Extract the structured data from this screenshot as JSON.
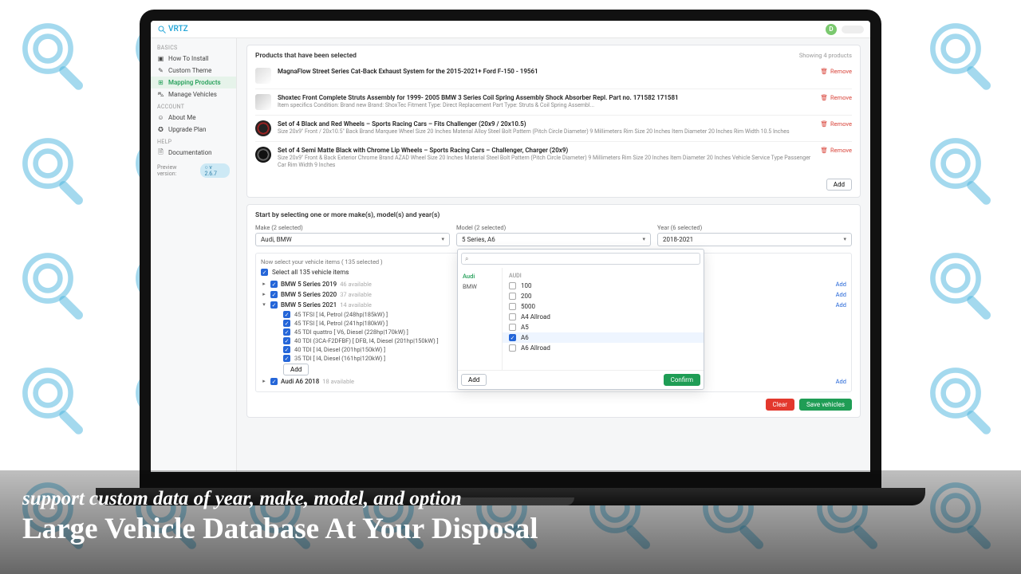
{
  "brand": "VRTZ",
  "userInitial": "D",
  "sidebar": {
    "groups": {
      "basics": "BASICS",
      "account": "ACCOUNT",
      "help": "HELP"
    },
    "items": {
      "install": "How To Install",
      "theme": "Custom Theme",
      "mapping": "Mapping Products",
      "vehicles": "Manage Vehicles",
      "about": "About Me",
      "upgrade": "Upgrade Plan",
      "docs": "Documentation"
    },
    "preview": {
      "label": "Preview version:",
      "version": "○ v 2.6.7"
    }
  },
  "products": {
    "title": "Products that have been selected",
    "showing": "Showing 4 products",
    "removeLabel": "Remove",
    "addLabel": "Add",
    "items": [
      {
        "title": "MagnaFlow Street Series Cat-Back Exhaust System for the 2015-2021+ Ford F-150 - 19561",
        "sub": ""
      },
      {
        "title": "Shoxtec Front Complete Struts Assembly for 1999- 2005 BMW 3 Series Coil Spring Assembly Shock Absorber Repl. Part no. 171582 171581",
        "sub": "Item specifics Condition: Brand new Brand: ShoxTec Fitment Type: Direct Replacement Part Type: Struts & Coil Spring Assembl..."
      },
      {
        "title": "Set of 4 Black and Red Wheels – Sports Racing Cars – Fits Challenger (20x9 / 20x10.5)",
        "sub": "Size 20x9\" Front / 20x10.5\" Back Brand Marquee Wheel Size 20 Inches Material Alloy Steel Bolt Pattern (Pitch Circle Diameter) 9 Millimeters Rim Size 20 Inches Item Diameter 20 Inches Rim Width 10.5 Inches"
      },
      {
        "title": "Set of 4 Semi Matte Black with Chrome Lip Wheels – Sports Racing Cars – Challenger, Charger (20x9)",
        "sub": "Size 20x9\" Front & Back Exterior Chrome Brand AZAD Wheel Size 20 Inches Material Steel Bolt Pattern (Pitch Circle Diameter) 9 Millimeters Rim Size 20 Inches Item Diameter 20 Inches Vehicle Service Type Passenger Car Rim Width 9 Inches"
      }
    ]
  },
  "selector": {
    "title": "Start by selecting one or more make(s), model(s) and year(s)",
    "make": {
      "label": "Make (2 selected)",
      "value": "Audi, BMW"
    },
    "model": {
      "label": "Model (2 selected)",
      "value": "5 Series, A6"
    },
    "year": {
      "label": "Year (6 selected)",
      "value": "2018-2021"
    },
    "dropdown": {
      "makes": [
        "Audi",
        "BMW"
      ],
      "group": "AUDI",
      "options": [
        {
          "label": "100",
          "checked": false
        },
        {
          "label": "200",
          "checked": false
        },
        {
          "label": "5000",
          "checked": false
        },
        {
          "label": "A4 Allroad",
          "checked": false
        },
        {
          "label": "A5",
          "checked": false
        },
        {
          "label": "A6",
          "checked": true
        },
        {
          "label": "A6 Allroad",
          "checked": false
        }
      ],
      "addLabel": "Add",
      "confirmLabel": "Confirm"
    }
  },
  "tree": {
    "head": "Now select your vehicle items ( 135 selected )",
    "selectAll": "Select all 135 vehicle items",
    "addLabel": "Add",
    "nodes": [
      {
        "name": "BMW 5 Series 2019",
        "avail": "46 available",
        "expanded": false
      },
      {
        "name": "BMW 5 Series 2020",
        "avail": "37 available",
        "expanded": false
      },
      {
        "name": "BMW 5 Series 2021",
        "avail": "14 available",
        "expanded": true,
        "children": [
          "45 TFSI [ I4, Petrol (248hp|185kW) ]",
          "45 TFSI [ I4, Petrol (241hp|180kW) ]",
          "45 TDI quattro [ V6, Diesel (228hp|170kW) ]",
          "40 TDI (3CA-F2DFBF) [ DFB, I4, Diesel (201hp|150kW) ]",
          "40 TDI [ I4, Diesel (201hp|150kW) ]",
          "35 TDI [ I4, Diesel (161hp|120kW) ]"
        ]
      },
      {
        "name": "Audi A6 2018",
        "avail": "18 available",
        "expanded": false
      }
    ]
  },
  "actions": {
    "clear": "Clear",
    "save": "Save vehicles"
  },
  "caption": {
    "l1": "support custom data of year, make, model, and option",
    "l2": "Large Vehicle Database At Your Disposal"
  }
}
